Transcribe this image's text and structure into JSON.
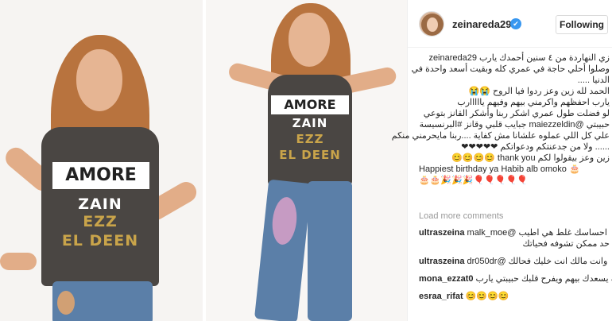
{
  "post": {
    "username": "zeinareda29",
    "follow_label": "Following",
    "verified_icon": "✔",
    "caption_lines": [
      "zeinareda29 زي النهاردة من ٤ سنين أحمدك يارب",
      "وصلوا أحلي حاجة في عمري كله وبقيت أسعد واحدة في",
      "الدنيا .....",
      "الحمد لله زين وعز ردوا فيا الروح 😭😭",
      "يارب احفظهم واكرمني بيهم وفيهم يااااارب",
      "لو فضلت طول عمري اشكر ربنا وأشكر القانز بتوعي",
      "حبيبتي @maiezzeldin جبايب قلبي وقانز #البرنسيسة",
      "علي كل اللي عملوه علشانا مش كفاية ....ربنا مايحرمني منكم",
      "...... ولا من جدعنتكم ودعواتكم ❤❤❤❤❤",
      "زين وعز بيقولوا لكم thank you 😊😊😊😊",
      "Happiest birthday ya Habib alb omoko 🎂",
      "🎂🎂🎉🎉🎉🎈🎈🎈🎈🎈"
    ],
    "load_more": "Load more comments",
    "comments": [
      {
        "user": "ultraszeina",
        "text": "احساسك غلط هي اطيب @malk_moe",
        "text2": "حد ممكن تشوفه فحياتك"
      },
      {
        "user": "ultraszeina",
        "text": "وانت مالك انت خليك فحالك @dr050dr",
        "text2": ""
      },
      {
        "user": "mona_ezzat0",
        "text": "الله يسعدك بيهم ويفرح قلبك حبيبتي يارب",
        "text2": ""
      },
      {
        "user": "esraa_rifat",
        "text": "😊😊😊😊",
        "text2": ""
      }
    ]
  },
  "photo": {
    "shirt_lines": [
      "AMORE",
      "ZAIN",
      "EZZ",
      "EL DEEN"
    ],
    "colors": {
      "gold_text": "#c9a44a",
      "shirt": "#4a4643",
      "hair": "#b8733e"
    }
  }
}
